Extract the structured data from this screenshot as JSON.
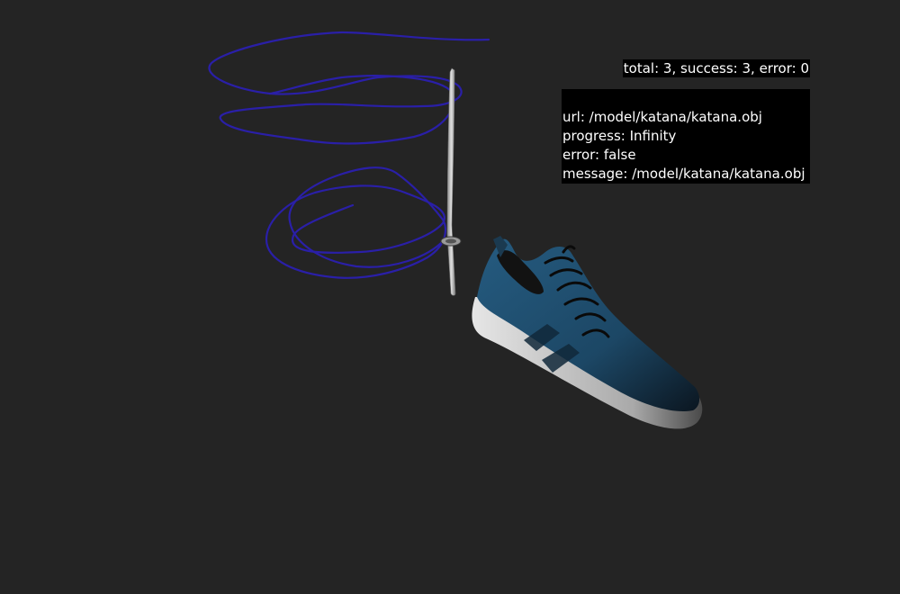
{
  "summary": {
    "text": "total: 3, success: 3, error: 0"
  },
  "load_log": {
    "entries": [
      {
        "url_line": "url: /model/katana/katana.obj",
        "progress_line": "progress: Infinity",
        "error_line": "error: false",
        "message_line": "message: /model/katana/katana.obj"
      }
    ]
  },
  "scene": {
    "background_color": "#242424",
    "models": [
      {
        "name": "spiral-curve",
        "color": "#2a1fa8"
      },
      {
        "name": "katana",
        "color": "#b8b8b8"
      },
      {
        "name": "sneaker",
        "color": "#1d4a6b",
        "sole_color": "#d8d8d8"
      }
    ]
  }
}
